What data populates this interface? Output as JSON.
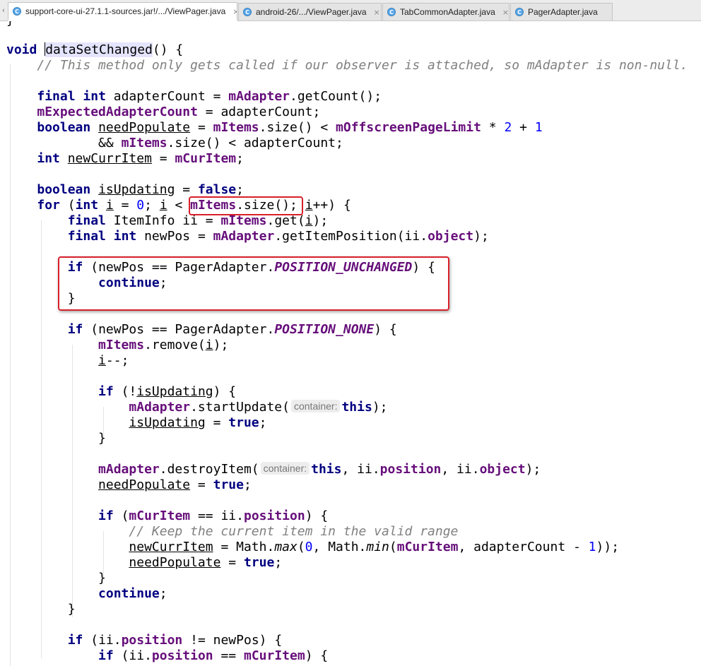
{
  "tabs": [
    {
      "label": "support-core-ui-27.1.1-sources.jar!/.../ViewPager.java",
      "icon": "class-icon",
      "active": true
    },
    {
      "label": "android-26/.../ViewPager.java",
      "icon": "class-icon",
      "active": false
    },
    {
      "label": "TabCommonAdapter.java",
      "icon": "class-icon",
      "active": false
    },
    {
      "label": "PagerAdapter.java",
      "icon": "class-icon",
      "active": false
    }
  ],
  "tab_class_letter": "C",
  "tab_close_glyph": "×",
  "tab_scroll_glyph": "‹",
  "code": {
    "top_partial": "}",
    "l1": {
      "kw": "void",
      "name": "dataSetChanged",
      "rest": "() {"
    },
    "l2": "// This method only gets called if our observer is attached, so mAdapter is non-null.",
    "l3": {
      "kw1": "final",
      "kw2": "int",
      "t1": " adapterCount = ",
      "f1": "mAdapter",
      "t2": ".getCount();"
    },
    "l4": {
      "f1": "mExpectedAdapterCount",
      "t1": " = adapterCount;"
    },
    "l5": {
      "kw1": "boolean",
      "v1": "needPopulate",
      "t1": " = ",
      "f1": "mItems",
      "t2": ".size() < ",
      "f2": "mOffscreenPageLimit",
      "t3": " * ",
      "n1": "2",
      "t4": " + ",
      "n2": "1"
    },
    "l6": {
      "t1": "&& ",
      "f1": "mItems",
      "t2": ".size() < adapterCount;"
    },
    "l7": {
      "kw1": "int",
      "v1": "newCurrItem",
      "t1": " = ",
      "f1": "mCurItem",
      "t2": ";"
    },
    "l8": {
      "kw1": "boolean",
      "v1": "isUpdating",
      "t1": " = ",
      "kw2": "false",
      "t2": ";"
    },
    "l9": {
      "kw1": "for",
      "t1": " (",
      "kw2": "int",
      "v1": "i",
      "t2": " = ",
      "n1": "0",
      "t3": "; ",
      "v2": "i",
      "t4": " < ",
      "f1": "mItems",
      "t5": ".size();",
      "v3": "i",
      "t6": "++) {"
    },
    "l10": {
      "kw1": "final",
      "t1": " ItemInfo ii = ",
      "f1": "mItems",
      "t2": ".get(",
      "v1": "i",
      "t3": ");"
    },
    "l11": {
      "kw1": "final",
      "kw2": "int",
      "t1": " newPos = ",
      "f1": "mAdapter",
      "t2": ".getItemPosition(ii.",
      "f2": "object",
      "t3": ");"
    },
    "l12": {
      "kw1": "if",
      "t1": " (newPos == PagerAdapter.",
      "c1": "POSITION_UNCHANGED",
      "t2": ") {"
    },
    "l13": {
      "kw1": "continue",
      "t1": ";"
    },
    "l14": "}",
    "l15": {
      "kw1": "if",
      "t1": " (newPos == PagerAdapter.",
      "c1": "POSITION_NONE",
      "t2": ") {"
    },
    "l16": {
      "f1": "mItems",
      "t1": ".remove(",
      "v1": "i",
      "t2": ");"
    },
    "l17": {
      "v1": "i",
      "t1": "--;"
    },
    "l18": {
      "kw1": "if",
      "t1": " (!",
      "v1": "isUpdating",
      "t2": ") {"
    },
    "l19": {
      "f1": "mAdapter",
      "t1": ".startUpdate(",
      "h1": "container:",
      "kw1": "this",
      "t2": ");"
    },
    "l20": {
      "v1": "isUpdating",
      "t1": " = ",
      "kw1": "true",
      "t2": ";"
    },
    "l21": "}",
    "l22": {
      "f1": "mAdapter",
      "t1": ".destroyItem(",
      "h1": "container:",
      "kw1": "this",
      "t2": ", ii.",
      "f2": "position",
      "t3": ", ii.",
      "f3": "object",
      "t4": ");"
    },
    "l23": {
      "v1": "needPopulate",
      "t1": " = ",
      "kw1": "true",
      "t2": ";"
    },
    "l24": {
      "kw1": "if",
      "t1": " (",
      "f1": "mCurItem",
      "t2": " == ii.",
      "f2": "position",
      "t3": ") {"
    },
    "l25": "// Keep the current item in the valid range",
    "l26": {
      "v1": "newCurrItem",
      "t1": " = Math.",
      "m1": "max",
      "t2": "(",
      "n1": "0",
      "t3": ", Math.",
      "m2": "min",
      "t4": "(",
      "f1": "mCurItem",
      "t5": ", adapterCount - ",
      "n2": "1",
      "t6": "));"
    },
    "l27": {
      "v1": "needPopulate",
      "t1": " = ",
      "kw1": "true",
      "t2": ";"
    },
    "l28": "}",
    "l29": {
      "kw1": "continue",
      "t1": ";"
    },
    "l30": "}",
    "l31": {
      "kw1": "if",
      "t1": " (ii.",
      "f1": "position",
      "t2": " != newPos) {"
    },
    "l32": {
      "kw1": "if",
      "t1": " (ii.",
      "f1": "position",
      "t2": " == ",
      "f2": "mCurItem",
      "t3": ") {"
    }
  },
  "colors": {
    "keyword": "#000080",
    "field": "#660e7a",
    "comment": "#808080",
    "number": "#0000ff",
    "annotation_box": "#d8202a",
    "tab_icon": "#58a7e8"
  }
}
